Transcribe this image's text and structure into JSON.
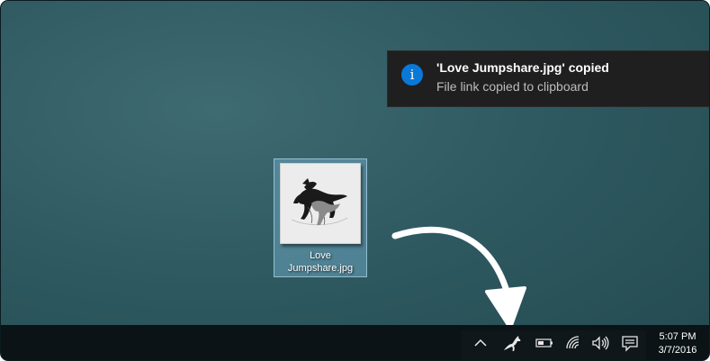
{
  "notification": {
    "icon": "info-icon",
    "icon_glyph": "i",
    "title": "'Love Jumpshare.jpg' copied",
    "message": "File link copied to clipboard",
    "accent": "#0a78d7"
  },
  "desktop": {
    "file": {
      "icon": "image-thumbnail",
      "label_line1": "Love",
      "label_line2": "Jumpshare.jpg"
    }
  },
  "taskbar": {
    "tray": {
      "items": [
        {
          "icon": "chevron-up-icon"
        },
        {
          "icon": "jumpshare-kangaroo-icon"
        },
        {
          "icon": "battery-icon"
        },
        {
          "icon": "wifi-icon"
        },
        {
          "icon": "volume-icon"
        },
        {
          "icon": "action-center-icon"
        }
      ]
    },
    "clock": {
      "time": "5:07 PM",
      "date": "3/7/2016"
    }
  },
  "colors": {
    "desktop_background": "#2f5a61",
    "taskbar": "#0b1316",
    "toast_background": "#1f1f1f"
  }
}
